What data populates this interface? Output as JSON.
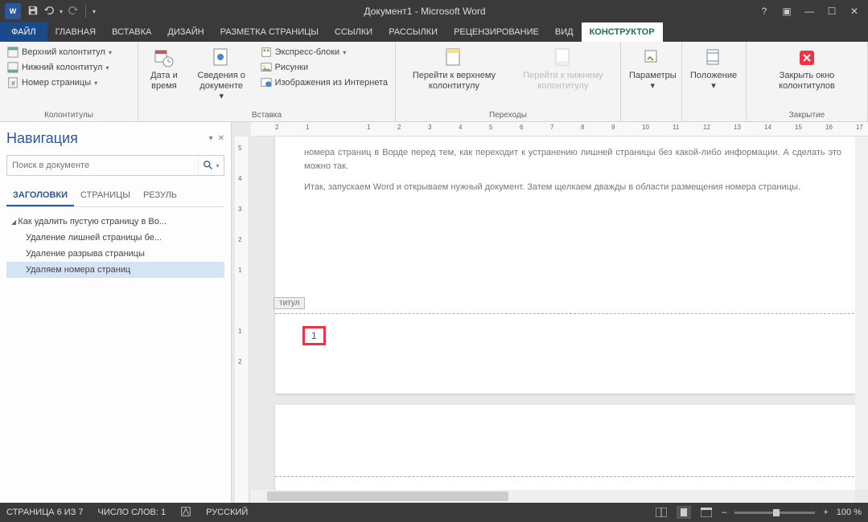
{
  "title": "Документ1 - Microsoft Word",
  "tabs": {
    "file": "ФАЙЛ",
    "items": [
      "ГЛАВНАЯ",
      "ВСТАВКА",
      "ДИЗАЙН",
      "РАЗМЕТКА СТРАНИЦЫ",
      "ССЫЛКИ",
      "РАССЫЛКИ",
      "РЕЦЕНЗИРОВАНИЕ",
      "ВИД",
      "КОНСТРУКТОР"
    ],
    "active": "КОНСТРУКТОР"
  },
  "ribbon": {
    "g1": {
      "header_footer": "Верхний колонтитул",
      "footer": "Нижний колонтитул",
      "page_number": "Номер страницы",
      "label": "Колонтитулы"
    },
    "g2": {
      "date_time": "Дата и время",
      "doc_info": "Сведения о документе",
      "quick_parts": "Экспресс-блоки",
      "pictures": "Рисунки",
      "online_pictures": "Изображения из Интернета",
      "label": "Вставка"
    },
    "g3": {
      "goto_header": "Перейти к верхнему колонтитулу",
      "goto_footer": "Перейти к нижнему колонтитулу",
      "label": "Переходы"
    },
    "g4": {
      "options": "Параметры",
      "label": ""
    },
    "g5": {
      "position": "Положение",
      "label": ""
    },
    "g6": {
      "close": "Закрыть окно колонтитулов",
      "label": "Закрытие"
    }
  },
  "nav": {
    "title": "Навигация",
    "search_placeholder": "Поиск в документе",
    "tabs": [
      "ЗАГОЛОВКИ",
      "СТРАНИЦЫ",
      "РЕЗУЛЬ"
    ],
    "headings": [
      {
        "lvl": 1,
        "text": "Как удалить пустую страницу в Во..."
      },
      {
        "lvl": 2,
        "text": "Удаление лишней страницы бе..."
      },
      {
        "lvl": 2,
        "text": "Удаление разрыва страницы"
      },
      {
        "lvl": 2,
        "text": "Удаляем номера страниц",
        "selected": true
      }
    ]
  },
  "document": {
    "para1": "номера страниц в Ворде перед тем, как переходит к устранению лишней страницы без какой-либо информации. А сделать это можно так.",
    "para2": "Итак, запускаем Word и открываем нужный документ. Затем щелкаем дважды в области размещения номера страницы.",
    "footer_tab": "титул",
    "page_number": "1"
  },
  "ruler_h": [
    "2",
    "1",
    "",
    "1",
    "2",
    "3",
    "4",
    "5",
    "6",
    "7",
    "8",
    "9",
    "10",
    "11",
    "12",
    "13",
    "14",
    "15",
    "16",
    "17"
  ],
  "ruler_v": [
    "5",
    "4",
    "3",
    "2",
    "1",
    "",
    "1",
    "2"
  ],
  "status": {
    "page": "СТРАНИЦА 6 ИЗ 7",
    "words": "ЧИСЛО СЛОВ: 1",
    "lang": "РУССКИЙ",
    "zoom": "100 %"
  }
}
